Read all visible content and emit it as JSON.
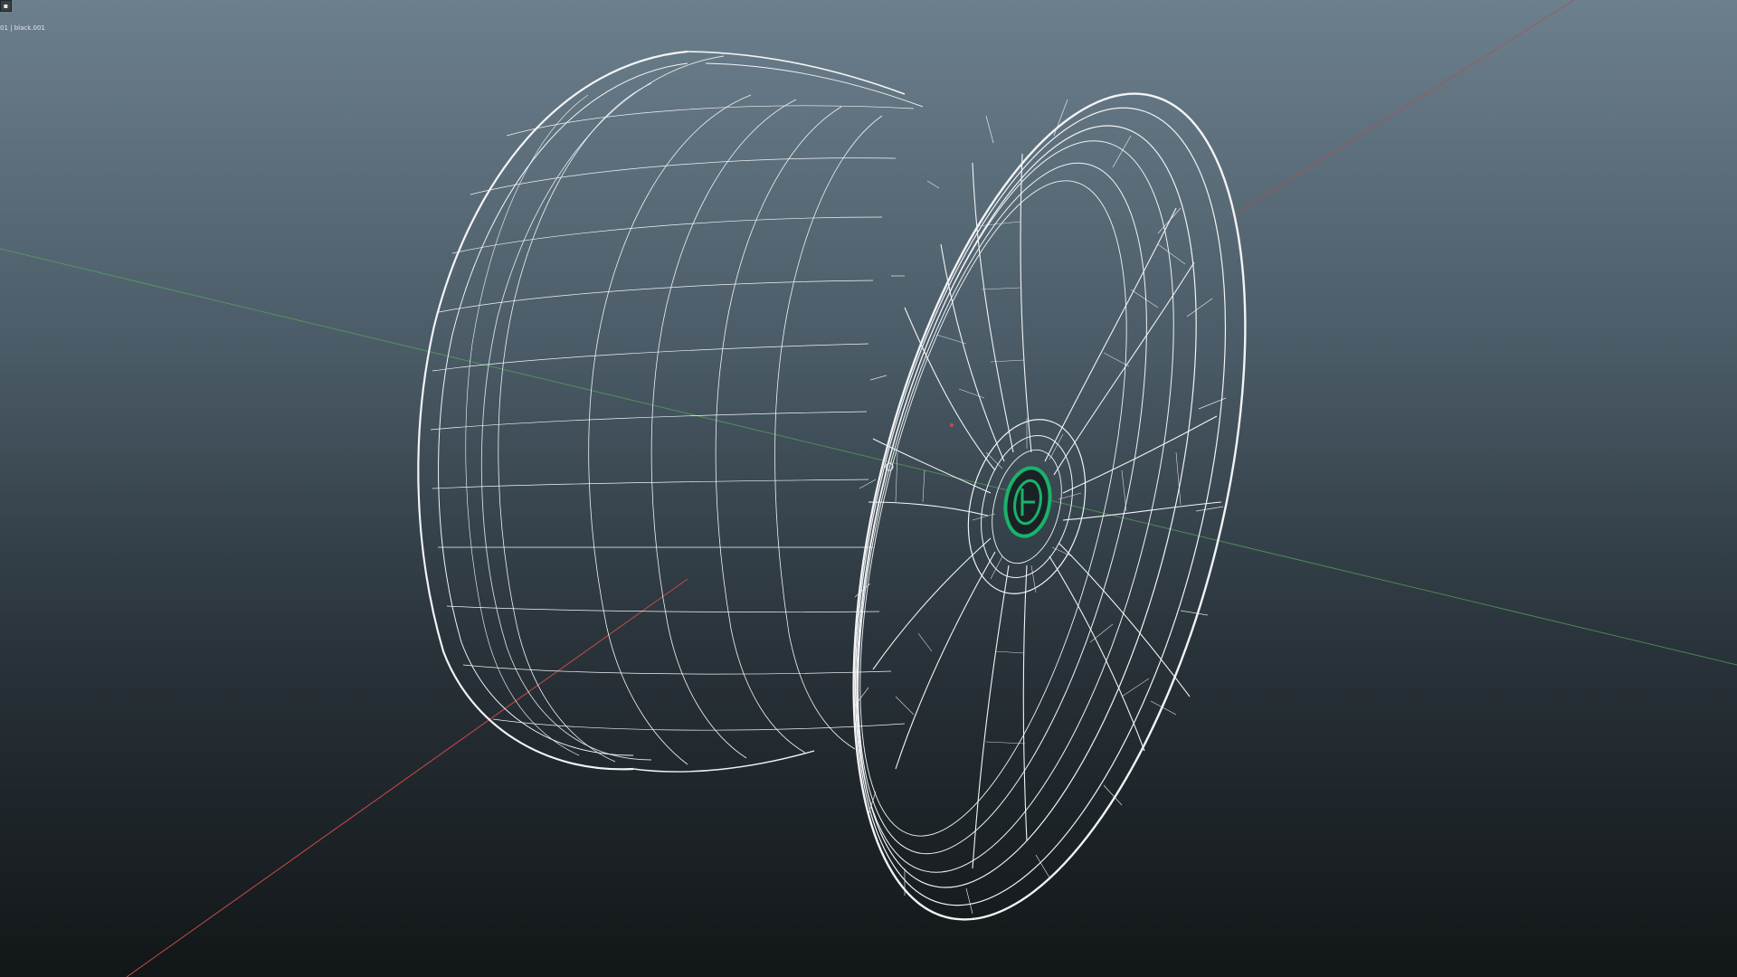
{
  "viewport": {
    "object_label": "01 | black.001",
    "corner_button_glyph": "▪",
    "axis_colors": {
      "x": "#c84a4a",
      "y": "#5aa85a",
      "z": "#6a8ad8"
    },
    "wire_color": "#f2f4f6",
    "emblem_color": "#19b36b"
  }
}
